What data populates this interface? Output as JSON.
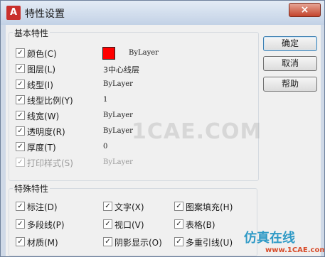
{
  "window": {
    "title": "特性设置",
    "close_glyph": "×"
  },
  "basic_group": {
    "title": "基本特性",
    "rows": [
      {
        "label": "颜色(C)",
        "checked": true,
        "value": "ByLayer",
        "swatch_color": "#ff0000"
      },
      {
        "label": "图层(L)",
        "checked": true,
        "value": "3中心线层"
      },
      {
        "label": "线型(I)",
        "checked": true,
        "value": "ByLayer"
      },
      {
        "label": "线型比例(Y)",
        "checked": true,
        "value": "1"
      },
      {
        "label": "线宽(W)",
        "checked": true,
        "value": "ByLayer"
      },
      {
        "label": "透明度(R)",
        "checked": true,
        "value": "ByLayer"
      },
      {
        "label": "厚度(T)",
        "checked": true,
        "value": "0"
      },
      {
        "label": "打印样式(S)",
        "checked": true,
        "disabled": true,
        "value": "ByLayer"
      }
    ]
  },
  "special_group": {
    "title": "特殊特性",
    "items": [
      {
        "label": "标注(D)",
        "checked": true
      },
      {
        "label": "文字(X)",
        "checked": true
      },
      {
        "label": "图案填充(H)",
        "checked": true
      },
      {
        "label": "多段线(P)",
        "checked": true
      },
      {
        "label": "视口(V)",
        "checked": true
      },
      {
        "label": "表格(B)",
        "checked": true
      },
      {
        "label": "材质(M)",
        "checked": true
      },
      {
        "label": "阴影显示(O)",
        "checked": true
      },
      {
        "label": "多重引线(U)",
        "checked": true
      }
    ]
  },
  "buttons": {
    "ok": "确定",
    "cancel": "取消",
    "help": "帮助"
  },
  "watermark": {
    "text": "1CAE.COM",
    "brand_cn": "仿真在线",
    "brand_url": "www.1CAE.com"
  },
  "check_glyph": "✓"
}
